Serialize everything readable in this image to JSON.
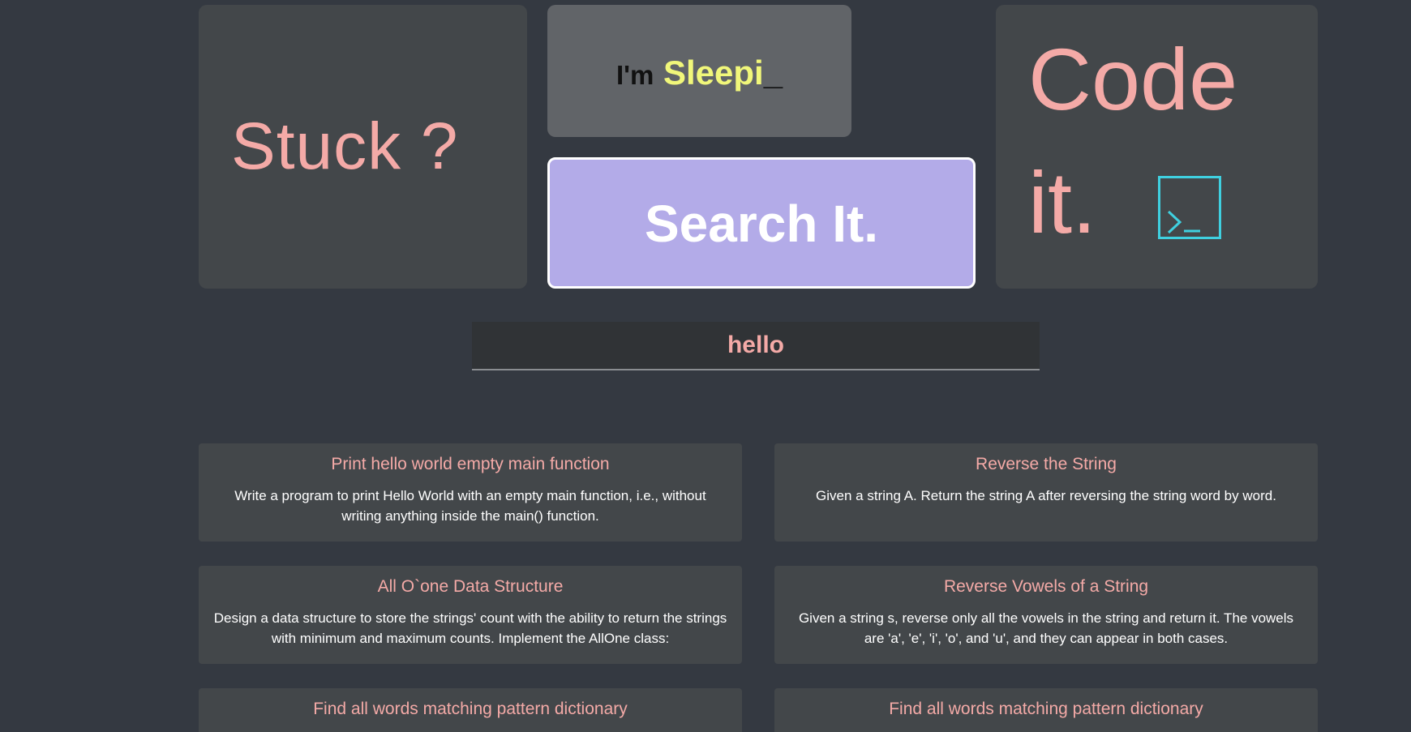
{
  "hero": {
    "stuck": "Stuck ?",
    "sleep_prefix": "I'm",
    "sleep_word": "Sleepi",
    "sleep_cursor": "_",
    "search_it": "Search It.",
    "code_word": "Code",
    "it_word": "it.",
    "terminal_icon": "terminal-icon"
  },
  "search": {
    "value": "hello",
    "placeholder": ""
  },
  "results": [
    {
      "title": "Print hello world empty main function",
      "description": "Write a program to print Hello World with an empty main function, i.e., without writing anything inside the main() function."
    },
    {
      "title": "Reverse the String",
      "description": "Given a string A. Return the string A after reversing the string word by word."
    },
    {
      "title": "All O`one Data Structure",
      "description": "Design a data structure to store the strings' count with the ability to return the strings with minimum and maximum counts. Implement the AllOne class:"
    },
    {
      "title": "Reverse Vowels of a String",
      "description": "Given a string s, reverse only all the vowels in the string and return it. The vowels are 'a', 'e', 'i', 'o', and 'u', and they can appear in both cases."
    },
    {
      "title": "Find all words matching pattern dictionary",
      "description": ""
    },
    {
      "title": "Find all words matching pattern dictionary",
      "description": ""
    }
  ],
  "colors": {
    "background": "#343941",
    "tile": "#43474a",
    "accent_pink": "#f4aaa7",
    "accent_yellow": "#f1f77a",
    "search_tile": "#b3abe8",
    "terminal_cyan": "#3fd0e0"
  }
}
